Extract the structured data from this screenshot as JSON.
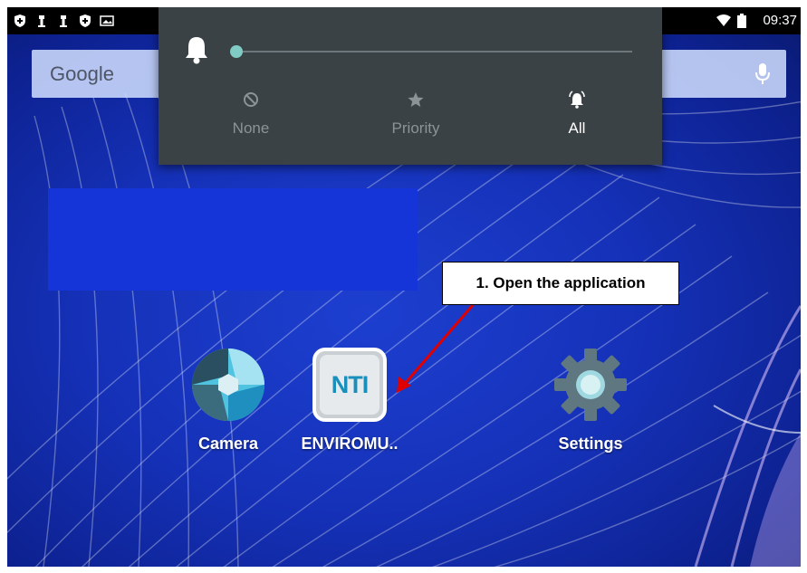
{
  "status_bar": {
    "time": "09:37",
    "left_icons": [
      "shield-icon",
      "usb-icon",
      "usb-icon",
      "shield-icon",
      "image-icon"
    ],
    "right_icons": [
      "wifi-icon",
      "battery-icon"
    ]
  },
  "search_bar": {
    "logo_text": "Google",
    "mic_icon": "mic-icon"
  },
  "volume_panel": {
    "icon": "bell-icon",
    "level": 0.0,
    "accent_color": "#80cbc4",
    "modes": [
      {
        "label": "None",
        "icon": "none-icon",
        "selected": false
      },
      {
        "label": "Priority",
        "icon": "star-icon",
        "selected": false
      },
      {
        "label": "All",
        "icon": "bell-ring-icon",
        "selected": true
      }
    ]
  },
  "apps": [
    {
      "label": "Camera",
      "icon": "camera-app-icon"
    },
    {
      "label": "ENVIROMU..",
      "icon": "nti-app-icon",
      "icon_text": "NTI"
    },
    {
      "label": "Settings",
      "icon": "settings-app-icon"
    }
  ],
  "annotation": {
    "text": "1. Open the application",
    "arrow_color": "#e00000"
  }
}
